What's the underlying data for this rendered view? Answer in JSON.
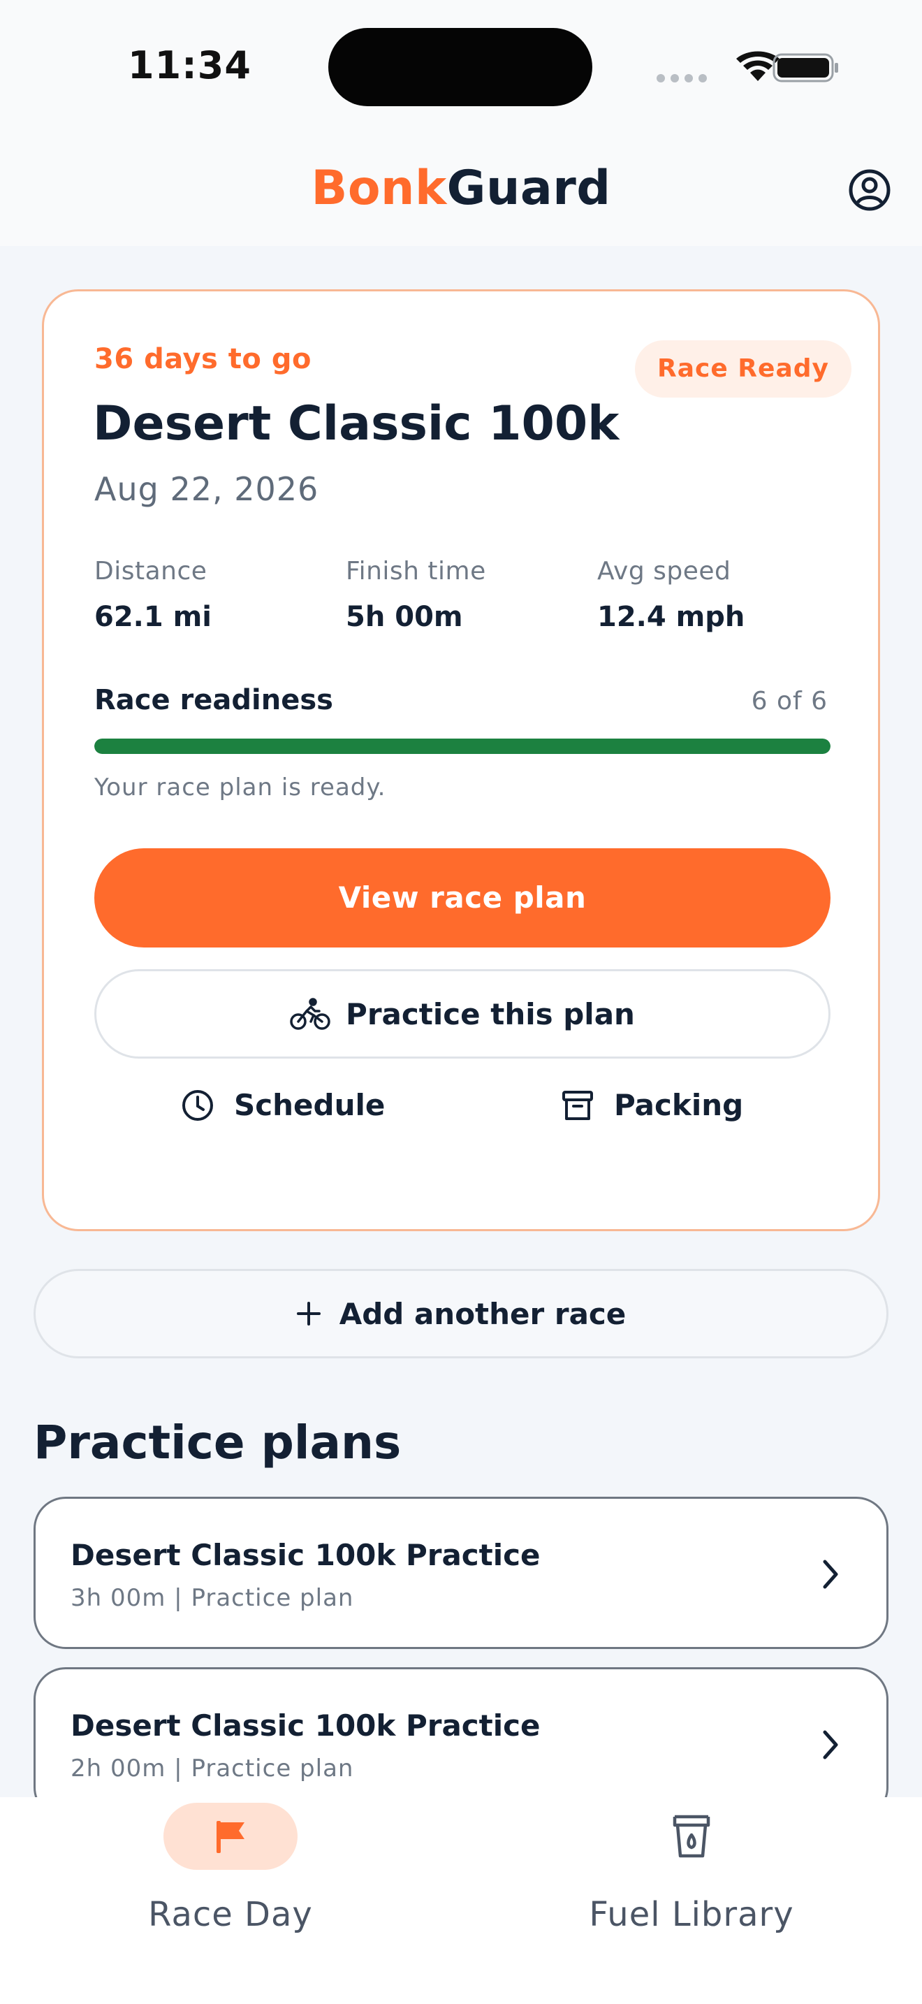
{
  "status_bar": {
    "time": "11:34"
  },
  "header": {
    "brand_part1": "Bonk",
    "brand_part2": "Guard"
  },
  "race": {
    "countdown": "36 days to go",
    "badge": "Race Ready",
    "name": "Desert Classic 100k",
    "date": "Aug 22, 2026",
    "stats": [
      {
        "label": "Distance",
        "value": "62.1 mi"
      },
      {
        "label": "Finish time",
        "value": "5h 00m"
      },
      {
        "label": "Avg speed",
        "value": "12.4 mph"
      }
    ],
    "readiness": {
      "label": "Race readiness",
      "count": "6 of 6",
      "completed": 6,
      "total": 6,
      "note": "Your race plan is ready."
    },
    "primary_action": "View race plan",
    "practice_action": "Practice this plan",
    "schedule_label": "Schedule",
    "packing_label": "Packing"
  },
  "add_race_label": "Add another race",
  "practice_section": {
    "title": "Practice plans",
    "plans": [
      {
        "title": "Desert Classic 100k Practice",
        "subtitle": "3h 00m | Practice plan"
      },
      {
        "title": "Desert Classic 100k Practice",
        "subtitle": "2h 00m | Practice plan"
      }
    ]
  },
  "tabs": [
    {
      "label": "Race Day",
      "icon": "flag-icon",
      "active": true
    },
    {
      "label": "Fuel Library",
      "icon": "cup-icon",
      "active": false
    }
  ],
  "colors": {
    "accent": "#ff6b2c",
    "accent_soft": "#fff0e8",
    "success": "#1c8140",
    "text": "#132033",
    "muted": "#6e7885"
  }
}
